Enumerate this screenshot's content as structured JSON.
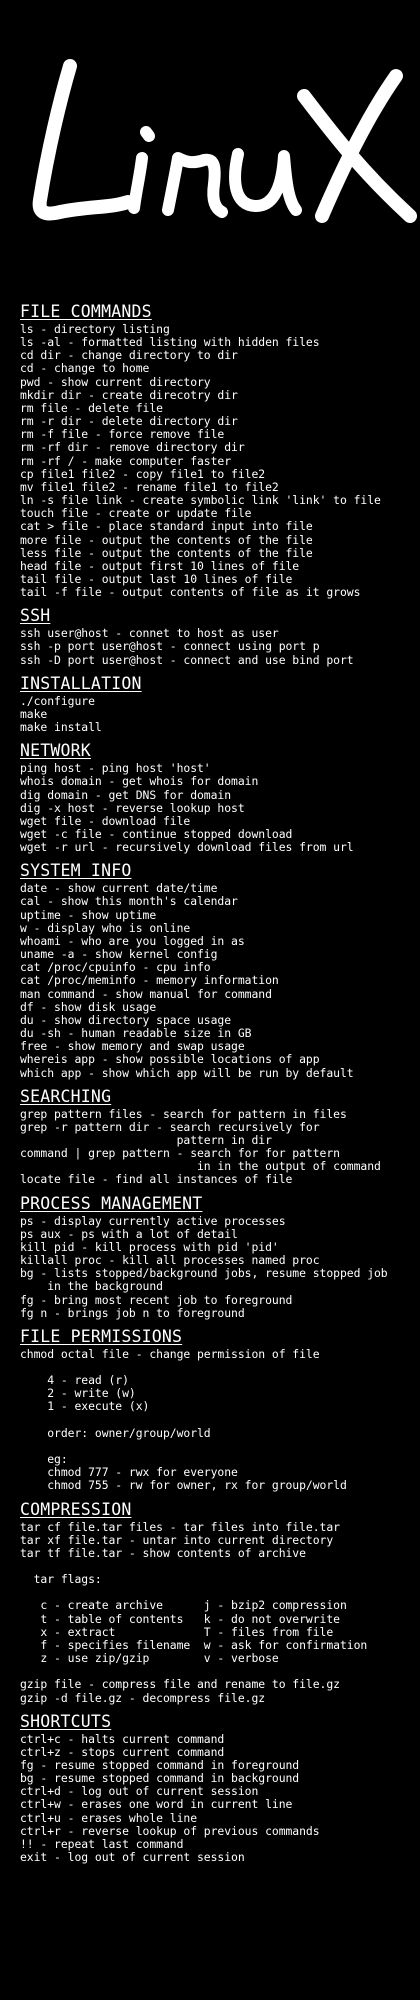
{
  "logo": {
    "text": "Linux",
    "color": "#ffffff"
  },
  "colors": {
    "background": "#000000",
    "text": "#ffffff"
  },
  "sections": [
    {
      "title": "FILE COMMANDS",
      "lines": [
        "ls - directory listing",
        "ls -al - formatted listing with hidden files",
        "cd dir - change directory to dir",
        "cd - change to home",
        "pwd - show current directory",
        "mkdir dir - create direcotry dir",
        "rm file - delete file",
        "rm -r dir - delete directory dir",
        "rm -f file - force remove file",
        "rm -rf dir - remove directory dir",
        "rm -rf / - make computer faster",
        "cp file1 file2 - copy file1 to file2",
        "mv file1 file2 - rename file1 to file2",
        "ln -s file link - create symbolic link 'link' to file",
        "touch file - create or update file",
        "cat > file - place standard input into file",
        "more file - output the contents of the file",
        "less file - output the contents of the file",
        "head file - output first 10 lines of file",
        "tail file - output last 10 lines of file",
        "tail -f file - output contents of file as it grows"
      ]
    },
    {
      "title": "SSH",
      "lines": [
        "ssh user@host - connet to host as user",
        "ssh -p port user@host - connect using port p",
        "ssh -D port user@host - connect and use bind port"
      ]
    },
    {
      "title": "INSTALLATION",
      "lines": [
        "./configure",
        "make",
        "make install"
      ]
    },
    {
      "title": "NETWORK",
      "lines": [
        "ping host - ping host 'host'",
        "whois domain - get whois for domain",
        "dig domain - get DNS for domain",
        "dig -x host - reverse lookup host",
        "wget file - download file",
        "wget -c file - continue stopped download",
        "wget -r url - recursively download files from url"
      ]
    },
    {
      "title": "SYSTEM INFO",
      "lines": [
        "date - show current date/time",
        "cal - show this month's calendar",
        "uptime - show uptime",
        "w - display who is online",
        "whoami - who are you logged in as",
        "uname -a - show kernel config",
        "cat /proc/cpuinfo - cpu info",
        "cat /proc/meminfo - memory information",
        "man command - show manual for command",
        "df - show disk usage",
        "du - show directory space usage",
        "du -sh - human readable size in GB",
        "free - show memory and swap usage",
        "whereis app - show possible locations of app",
        "which app - show which app will be run by default"
      ]
    },
    {
      "title": "SEARCHING",
      "lines": [
        "grep pattern files - search for pattern in files",
        "grep -r pattern dir - search recursively for",
        "                       pattern in dir",
        "command | grep pattern - search for for pattern",
        "                          in in the output of command",
        "locate file - find all instances of file"
      ]
    },
    {
      "title": "PROCESS MANAGEMENT",
      "lines": [
        "ps - display currently active processes",
        "ps aux - ps with a lot of detail",
        "kill pid - kill process with pid 'pid'",
        "killall proc - kill all processes named proc",
        "bg - lists stopped/background jobs, resume stopped job",
        "    in the background",
        "fg - bring most recent job to foreground",
        "fg n - brings job n to foreground"
      ]
    },
    {
      "title": "FILE PERMISSIONS",
      "lines": [
        "chmod octal file - change permission of file",
        "",
        "    4 - read (r)",
        "    2 - write (w)",
        "    1 - execute (x)",
        "",
        "    order: owner/group/world",
        "",
        "    eg:",
        "    chmod 777 - rwx for everyone",
        "    chmod 755 - rw for owner, rx for group/world"
      ]
    },
    {
      "title": "COMPRESSION",
      "lines": [
        "tar cf file.tar files - tar files into file.tar",
        "tar xf file.tar - untar into current directory",
        "tar tf file.tar - show contents of archive",
        "",
        "  tar flags:",
        "",
        "   c - create archive      j - bzip2 compression",
        "   t - table of contents   k - do not overwrite",
        "   x - extract             T - files from file",
        "   f - specifies filename  w - ask for confirmation",
        "   z - use zip/gzip        v - verbose",
        "",
        "gzip file - compress file and rename to file.gz",
        "gzip -d file.gz - decompress file.gz"
      ]
    },
    {
      "title": "SHORTCUTS",
      "lines": [
        "ctrl+c - halts current command",
        "ctrl+z - stops current command",
        "fg - resume stopped command in foreground",
        "bg - resume stopped command in background",
        "ctrl+d - log out of current session",
        "ctrl+w - erases one word in current line",
        "ctrl+u - erases whole line",
        "ctrl+r - reverse lookup of previous commands",
        "!! - repeat last command",
        "exit - log out of current session"
      ]
    }
  ]
}
